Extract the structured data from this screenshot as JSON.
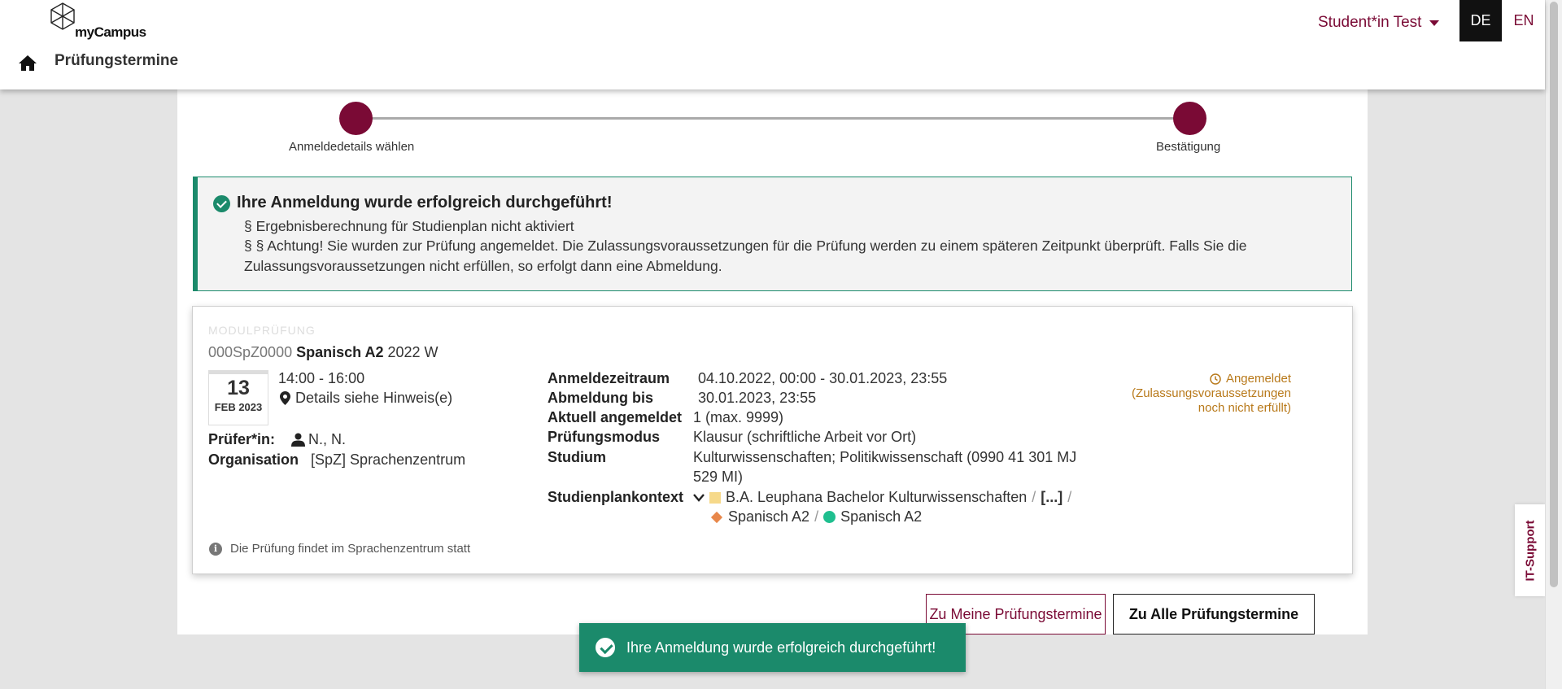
{
  "header": {
    "logo_text": "myCampus",
    "page_title": "Prüfungstermine",
    "user": "Student*in Test",
    "lang_de": "DE",
    "lang_en": "EN"
  },
  "stepper": {
    "step1": "Anmeldedetails wählen",
    "step2": "Bestätigung"
  },
  "alert": {
    "title": "Ihre Anmeldung wurde erfolgreich durchgeführt!",
    "line1": "§ Ergebnisberechnung für Studienplan nicht aktiviert",
    "line2": "§ § Achtung! Sie wurden zur Prüfung angemeldet. Die Zulassungsvoraussetzungen für die Prüfung werden zu einem späteren Zeitpunkt überprüft. Falls Sie die Zulassungsvoraussetzungen nicht erfüllen, so erfolgt dann eine Abmeldung."
  },
  "exam": {
    "type": "MODULPRÜFUNG",
    "code": "000SpZ0000",
    "name": "Spanisch A2",
    "term": "2022 W",
    "day": "13",
    "month_year": "FEB 2023",
    "time": "14:00 - 16:00",
    "location": "Details siehe Hinweis(e)",
    "examiner_label": "Prüfer*in:",
    "examiner": "N., N.",
    "org_label": "Organisation",
    "org": "[SpZ] Sprachenzentrum",
    "details": {
      "reg_period_label": "Anmeldezeitraum",
      "reg_period": "04.10.2022, 00:00 - 30.01.2023, 23:55",
      "dereg_label": "Abmeldung bis",
      "dereg": "30.01.2023, 23:55",
      "current_label": "Aktuell angemeldet",
      "current": "1 (max. 9999)",
      "mode_label": "Prüfungsmodus",
      "mode": "Klausur (schriftliche Arbeit vor Ort)",
      "study_label": "Studium",
      "study_line1": "Kulturwissenschaften; Politikwissenschaft (0990 41 301 MJ",
      "study_line2": "529 MI)",
      "context_label": "Studienplankontext",
      "context_1": "B.A. Leuphana Bachelor Kulturwissenschaften",
      "context_ellipsis": "[...]",
      "context_2": "Spanisch A2",
      "context_3": "Spanisch A2",
      "separator": "/"
    },
    "status_title": "Angemeldet",
    "status_note": "(Zulassungsvoraussetzungen noch nicht erfüllt)",
    "hint": "Die Prüfung findet im Sprachenzentrum statt"
  },
  "buttons": {
    "my_exams": "Zu Meine Prüfungstermine",
    "all_exams": "Zu Alle Prüfungstermine"
  },
  "toast": "Ihre Anmeldung wurde erfolgreich durchgeführt!",
  "support": "IT-Support",
  "colors": {
    "brand": "#7a0a35",
    "success": "#1b8a6b",
    "warning": "#b8791a"
  }
}
